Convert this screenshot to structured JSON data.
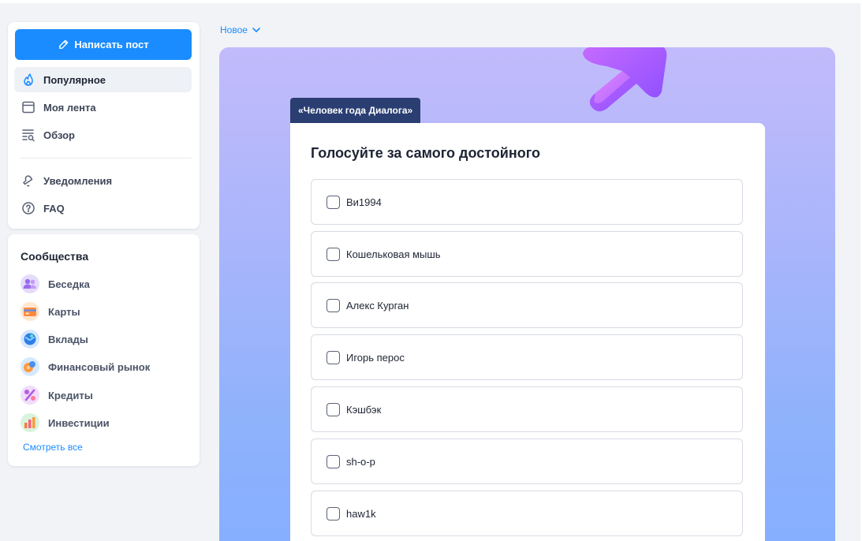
{
  "sidebar": {
    "write_button": "Написать пост",
    "nav": [
      {
        "label": "Популярное",
        "icon": "fire-icon",
        "active": true
      },
      {
        "label": "Моя лента",
        "icon": "feed-icon",
        "active": false
      },
      {
        "label": "Обзор",
        "icon": "search-list-icon",
        "active": false
      },
      {
        "label": "Уведомления",
        "icon": "bell-icon",
        "active": false
      },
      {
        "label": "FAQ",
        "icon": "question-icon",
        "active": false
      }
    ],
    "communities_title": "Сообщества",
    "communities": [
      {
        "label": "Беседка",
        "icon": "people-icon",
        "color": "#b08cf5"
      },
      {
        "label": "Карты",
        "icon": "card-icon",
        "color": "#ffb36b"
      },
      {
        "label": "Вклады",
        "icon": "globe-icon",
        "color": "#5ca8ff"
      },
      {
        "label": "Финансовый рынок",
        "icon": "market-icon",
        "color": "#ffa14d"
      },
      {
        "label": "Кредиты",
        "icon": "percent-icon",
        "color": "#c58af0"
      },
      {
        "label": "Инвестиции",
        "icon": "chart-icon",
        "color": "#ff8a5c"
      }
    ],
    "see_all": "Смотреть все"
  },
  "main": {
    "sort_label": "Новое",
    "tag": "«Человек года Диалога»",
    "poll": {
      "title": "Голосуйте за самого достойного",
      "options": [
        "Ви1994",
        "Кошельковая мышь",
        "Алекс Курган",
        "Игорь перос",
        "Кэшбэк",
        "sh-o-p",
        "haw1k"
      ]
    }
  },
  "colors": {
    "accent": "#1a8cff",
    "tag_bg": "#2a3e72",
    "banner_top": "#c2bbfb",
    "banner_bottom": "#86afff"
  }
}
